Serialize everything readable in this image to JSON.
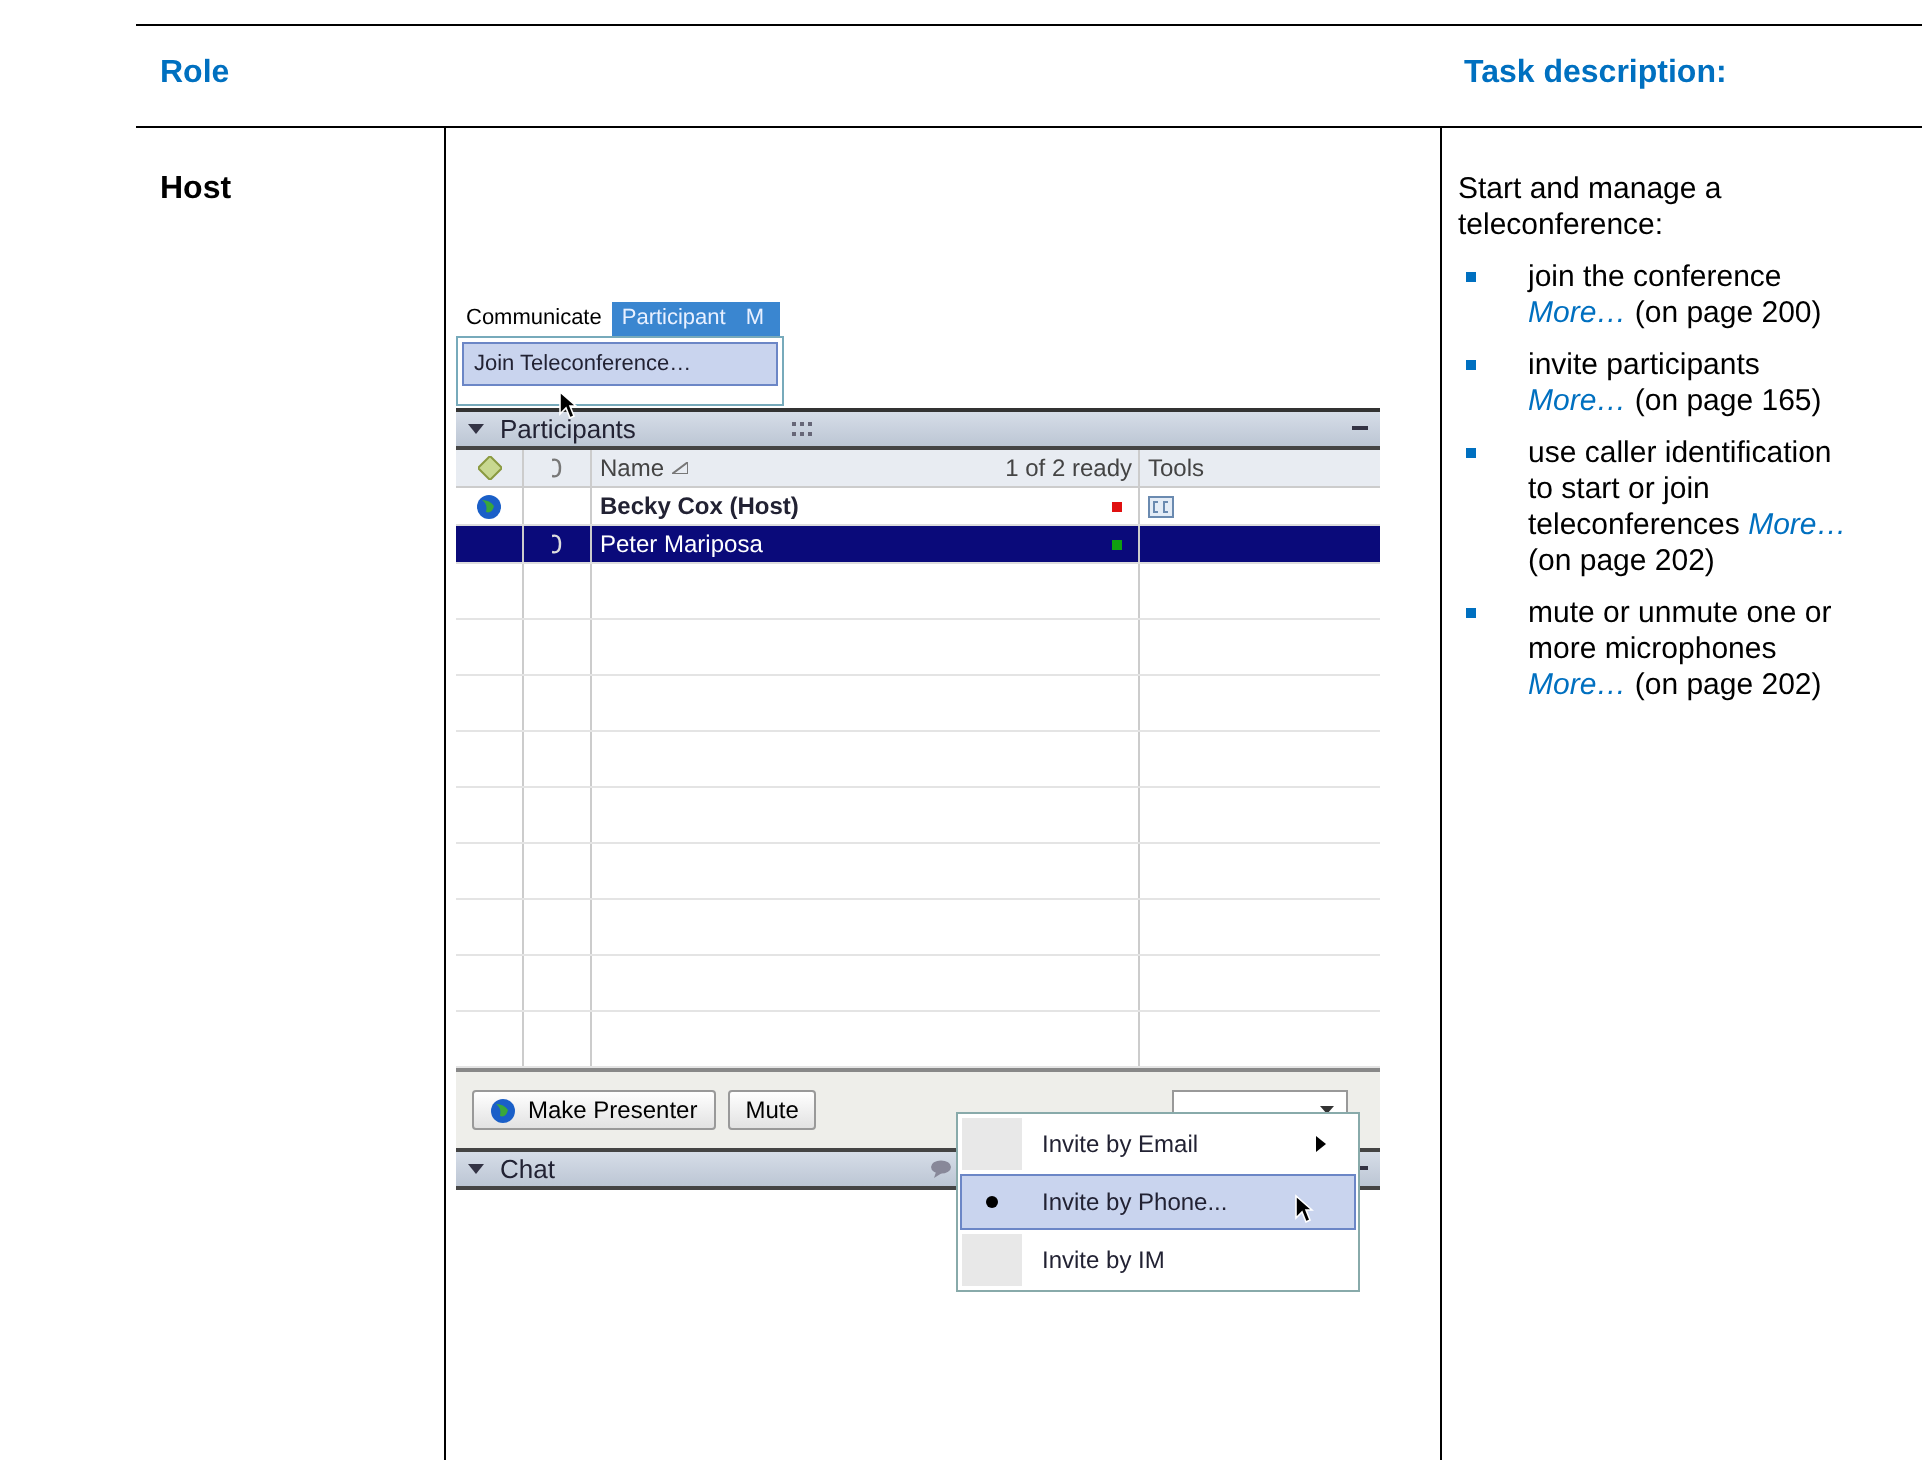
{
  "table": {
    "header": {
      "role": "Role",
      "task": "Task description:"
    },
    "row": {
      "role": "Host",
      "intro": "Start and manage a teleconference:",
      "tasks": [
        {
          "text": "join the conference",
          "link": "More…",
          "after": "(on page 200)"
        },
        {
          "text": "invite participants",
          "link": "More…",
          "after": "(on page 165)"
        },
        {
          "text": "use caller identification to start or join teleconferences",
          "link": "More…",
          "after": "(on page 202)"
        },
        {
          "text": "mute or unmute one or more microphones",
          "link": "More…",
          "after": "(on page 202)"
        }
      ]
    }
  },
  "screenshot": {
    "menu_bar": [
      {
        "label": "Communicate",
        "selected": true
      },
      {
        "label": "Participant",
        "selected": false
      },
      {
        "label": "M",
        "selected": false
      }
    ],
    "menu": [
      {
        "label": "Join Teleconference…",
        "selected": true
      }
    ],
    "participants": {
      "title": "Participants",
      "columns": [
        "Name",
        "1 of 2 ready",
        "Tools"
      ],
      "rows": [
        {
          "kind": "host",
          "name": "Becky Cox (Host)",
          "color": "#e01010",
          "selected": false
        },
        {
          "kind": "phone",
          "name": "Peter Mariposa",
          "color": "#10a010",
          "selected": true
        }
      ]
    },
    "buttons": [
      "Make Presenter",
      "Mute"
    ],
    "chat": {
      "title": "Chat"
    },
    "popup": [
      {
        "label": "Invite by Email",
        "submenu": true,
        "selected": false
      },
      {
        "label": "Invite by Phone...",
        "submenu": false,
        "selected": true
      },
      {
        "label": "Invite by IM",
        "submenu": false,
        "selected": false
      }
    ]
  }
}
